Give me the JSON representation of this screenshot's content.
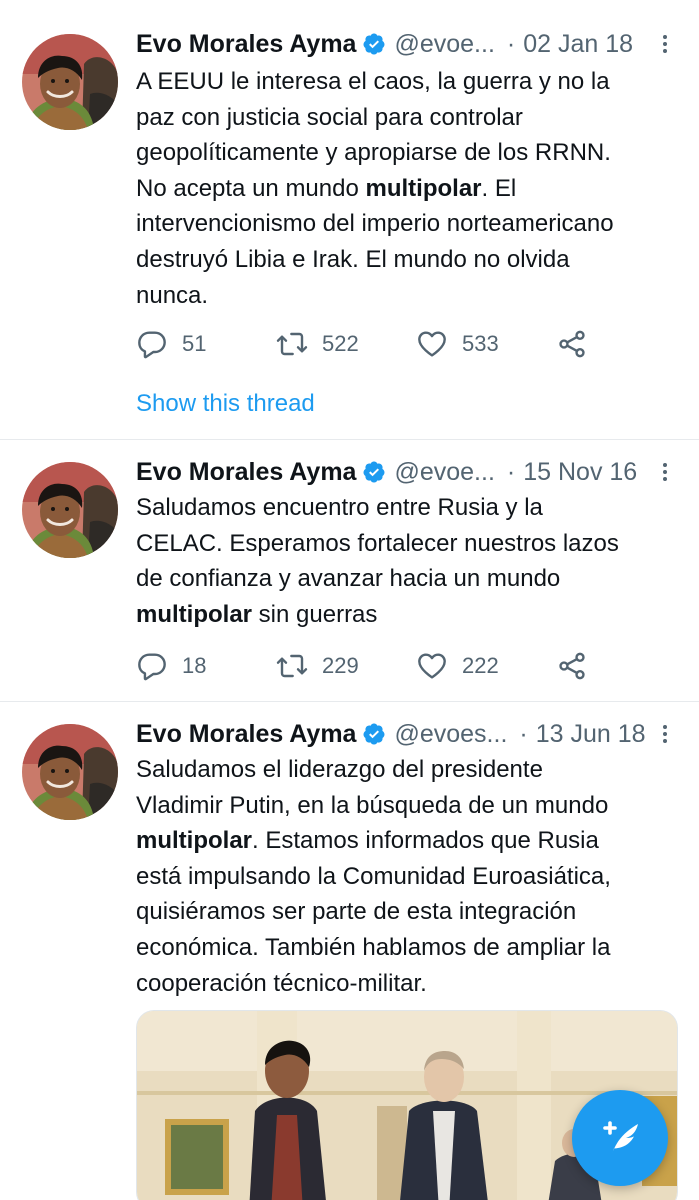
{
  "tweets": [
    {
      "name": "Evo Morales Ayma",
      "handle": "@evoe...",
      "separator": "·",
      "date": "02 Jan 18",
      "text_parts": [
        "A EEUU le interesa el caos, la guerra y no la",
        "paz con justicia social para controlar",
        "geopolíticamente y apropiarse de los RRNN.",
        "No acepta un mundo ",
        "multipolar",
        ". El",
        "intervencionismo del imperio norteamericano",
        "destruyó Libia e Irak. El mundo no olvida",
        "nunca."
      ],
      "replies": "51",
      "retweets": "522",
      "likes": "533",
      "show_thread": "Show this thread"
    },
    {
      "name": "Evo Morales Ayma",
      "handle": "@evoe...",
      "separator": "·",
      "date": "15 Nov 16",
      "text_parts": [
        "Saludamos encuentro entre Rusia y la",
        "CELAC. Esperamos fortalecer nuestros lazos",
        "de confianza y avanzar hacia un mundo",
        "multipolar",
        " sin guerras"
      ],
      "replies": "18",
      "retweets": "229",
      "likes": "222"
    },
    {
      "name": "Evo Morales Ayma",
      "handle": "@evoes...",
      "separator": "·",
      "date": "13 Jun 18",
      "text_parts": [
        "Saludamos el liderazgo del presidente",
        "Vladimir Putin, en la búsqueda de un mundo",
        "multipolar",
        ". Estamos informados que Rusia",
        "está impulsando la Comunidad Euroasiática,",
        "quisiéramos ser parte de esta integración",
        "económica. También hablamos de ampliar la",
        "cooperación técnico-militar."
      ]
    }
  ],
  "colors": {
    "accent": "#1d9bf0",
    "secondary_text": "#536471",
    "divider": "#e7eaed"
  },
  "icons": {
    "reply": "reply-icon",
    "retweet": "retweet-icon",
    "like": "heart-icon",
    "share": "share-icon",
    "more": "more-vertical-icon",
    "verified": "verified-badge-icon",
    "compose": "compose-tweet-icon"
  }
}
